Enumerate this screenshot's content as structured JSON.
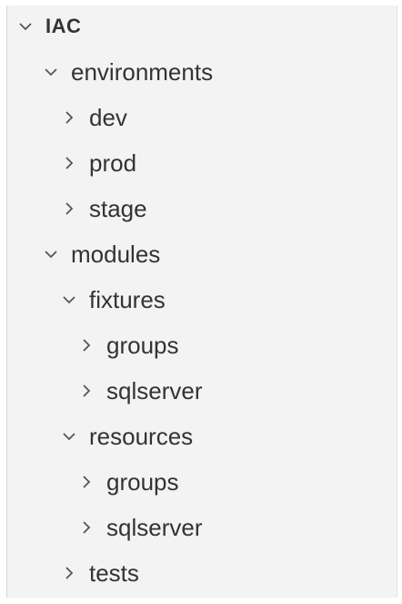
{
  "explorer": {
    "root": {
      "label": "IAC",
      "expanded": true
    },
    "items": [
      {
        "label": "environments",
        "expanded": true,
        "depth": 1
      },
      {
        "label": "dev",
        "expanded": false,
        "depth": 2
      },
      {
        "label": "prod",
        "expanded": false,
        "depth": 2
      },
      {
        "label": "stage",
        "expanded": false,
        "depth": 2
      },
      {
        "label": "modules",
        "expanded": true,
        "depth": 1
      },
      {
        "label": "fixtures",
        "expanded": true,
        "depth": 2
      },
      {
        "label": "groups",
        "expanded": false,
        "depth": 3
      },
      {
        "label": "sqlserver",
        "expanded": false,
        "depth": 3
      },
      {
        "label": "resources",
        "expanded": true,
        "depth": 2
      },
      {
        "label": "groups",
        "expanded": false,
        "depth": 3
      },
      {
        "label": "sqlserver",
        "expanded": false,
        "depth": 3
      },
      {
        "label": "tests",
        "expanded": false,
        "depth": 2
      }
    ]
  },
  "icons": {
    "expanded": "chevron-down-icon",
    "collapsed": "chevron-right-icon"
  },
  "colors": {
    "background": "#f3f3f3",
    "text": "#333333",
    "chevron": "#555555"
  }
}
